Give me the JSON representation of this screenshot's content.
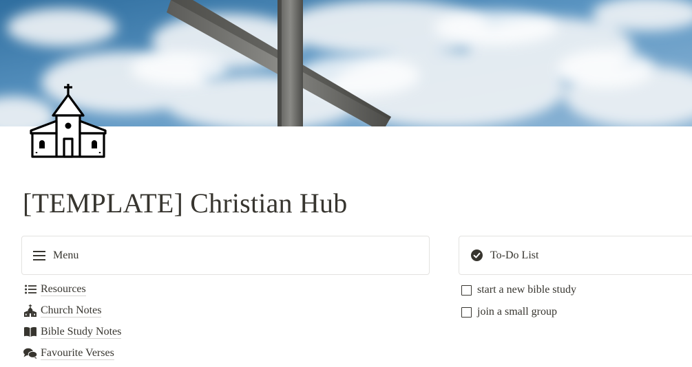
{
  "page": {
    "title": "[TEMPLATE] Christian Hub",
    "cover": "cross against cloudy blue sky",
    "icon": "church-icon"
  },
  "menu_callout": {
    "icon": "hamburger-icon",
    "label": "Menu"
  },
  "menu_links": [
    {
      "label": "Resources",
      "icon": "list-icon"
    },
    {
      "label": "Church Notes",
      "icon": "church-small-icon"
    },
    {
      "label": "Bible Study Notes",
      "icon": "open-book-icon"
    },
    {
      "label": "Favourite Verses",
      "icon": "chat-bubbles-icon"
    }
  ],
  "todo_callout": {
    "icon": "check-circle-icon",
    "label": "To-Do List"
  },
  "todos": [
    {
      "label": "start a new bible study",
      "checked": false
    },
    {
      "label": "join a small group",
      "checked": false
    }
  ],
  "colors": {
    "text": "#37352f",
    "border": "#e3e2e0",
    "sky": "#3d7fb5"
  }
}
